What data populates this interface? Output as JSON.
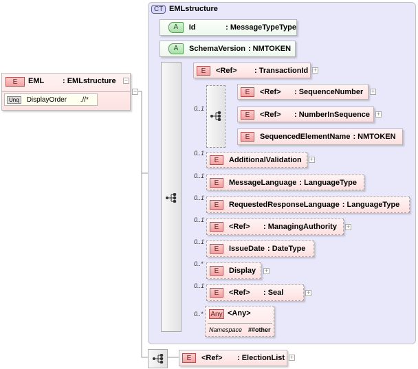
{
  "root": {
    "badge": "E",
    "name": "EML",
    "type": ": EMLstructure",
    "constraint": {
      "badge": "Unq",
      "name": "DisplayOrder",
      "xpath": ".//*"
    }
  },
  "complex_type": {
    "badge": "CT",
    "name": "EMLstructure"
  },
  "attributes": [
    {
      "badge": "A",
      "name": "Id",
      "type": ": MessageTypeType"
    },
    {
      "badge": "A",
      "name": "SchemaVersion",
      "type": ": NMTOKEN"
    }
  ],
  "elements": [
    {
      "badge": "E",
      "name": "<Ref>",
      "type": ": TransactionId",
      "occurs": ""
    },
    {
      "badge": "E",
      "name": "<Ref>",
      "type": ": SequenceNumber",
      "occurs": ""
    },
    {
      "badge": "E",
      "name": "<Ref>",
      "type": ": NumberInSequence",
      "occurs": ""
    },
    {
      "badge": "E",
      "name": "SequencedElementName",
      "type": ": NMTOKEN",
      "occurs": ""
    },
    {
      "badge": "E",
      "name": "AdditionalValidation",
      "type": "",
      "occurs": "0..1"
    },
    {
      "badge": "E",
      "name": "MessageLanguage",
      "type": ": LanguageType",
      "occurs": "0..1"
    },
    {
      "badge": "E",
      "name": "RequestedResponseLanguage",
      "type": ": LanguageType",
      "occurs": "0..1"
    },
    {
      "badge": "E",
      "name": "<Ref>",
      "type": ": ManagingAuthority",
      "occurs": "0..1"
    },
    {
      "badge": "E",
      "name": "IssueDate",
      "type": ": DateType",
      "occurs": "0..1"
    },
    {
      "badge": "E",
      "name": "Display",
      "type": "",
      "occurs": "0..*"
    },
    {
      "badge": "E",
      "name": "<Ref>",
      "type": ": Seal",
      "occurs": "0..1"
    },
    {
      "badge": "E",
      "name": "<Ref>",
      "type": ": ElectionList",
      "occurs": ""
    }
  ],
  "inner_sequence_occurs": "0..1",
  "any": {
    "badge": "Any",
    "name": "<Any>",
    "occurs": "0..*",
    "ns_label": "Namespace",
    "ns_value": "##other"
  },
  "colors": {
    "element": "#fde0e0",
    "attribute": "#eef8ee",
    "complex_type": "#e8e8fa"
  }
}
